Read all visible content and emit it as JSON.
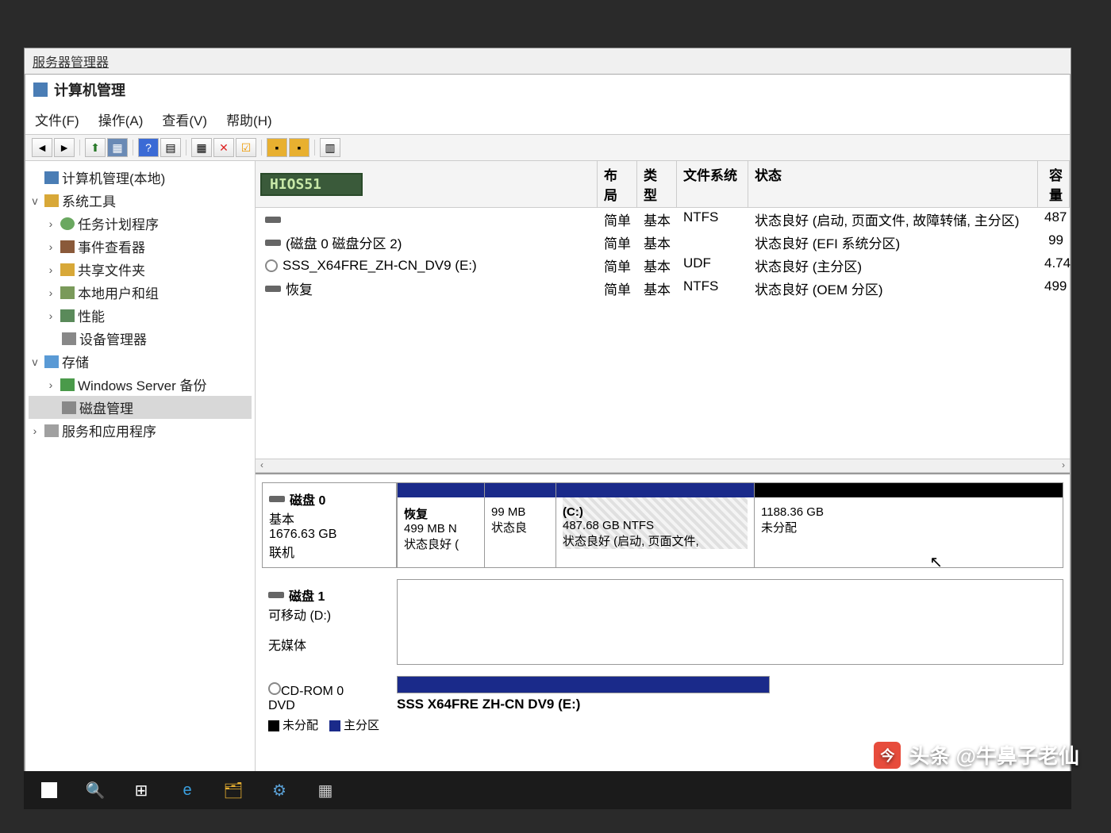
{
  "parentWindow": "服务器管理器",
  "window": {
    "title": "计算机管理",
    "menu": {
      "file": "文件(F)",
      "action": "操作(A)",
      "view": "查看(V)",
      "help": "帮助(H)"
    }
  },
  "tree": {
    "root": "计算机管理(本地)",
    "systemTools": "系统工具",
    "taskScheduler": "任务计划程序",
    "eventViewer": "事件查看器",
    "sharedFolders": "共享文件夹",
    "localUsers": "本地用户和组",
    "performance": "性能",
    "deviceManager": "设备管理器",
    "storage": "存储",
    "wsBackup": "Windows Server 备份",
    "diskMgmt": "磁盘管理",
    "services": "服务和应用程序"
  },
  "headerTag": "HIOS51",
  "columns": {
    "layout": "布局",
    "type": "类型",
    "fs": "文件系统",
    "status": "状态",
    "capacity": "容量"
  },
  "volumes": [
    {
      "name": "",
      "icon": "disk",
      "layout": "简单",
      "type": "基本",
      "fs": "NTFS",
      "status": "状态良好 (启动, 页面文件, 故障转储, 主分区)",
      "cap": "487"
    },
    {
      "name": "(磁盘 0 磁盘分区 2)",
      "icon": "disk",
      "layout": "简单",
      "type": "基本",
      "fs": "",
      "status": "状态良好 (EFI 系统分区)",
      "cap": "99"
    },
    {
      "name": "SSS_X64FRE_ZH-CN_DV9 (E:)",
      "icon": "cd",
      "layout": "简单",
      "type": "基本",
      "fs": "UDF",
      "status": "状态良好 (主分区)",
      "cap": "4.74"
    },
    {
      "name": "恢复",
      "icon": "disk",
      "layout": "简单",
      "type": "基本",
      "fs": "NTFS",
      "status": "状态良好 (OEM 分区)",
      "cap": "499"
    }
  ],
  "disk0": {
    "title": "磁盘 0",
    "type": "基本",
    "size": "1676.63 GB",
    "status": "联机",
    "parts": [
      {
        "name": "恢复",
        "info": "499 MB N",
        "status": "状态良好 ("
      },
      {
        "name": "",
        "info": "99 MB",
        "status": "状态良"
      },
      {
        "name": "(C:)",
        "info": "487.68 GB NTFS",
        "status": "状态良好 (启动, 页面文件,"
      },
      {
        "name": "",
        "info": "1188.36 GB",
        "status": "未分配"
      }
    ]
  },
  "disk1": {
    "title": "磁盘 1",
    "type": "可移动 (D:)",
    "status": "无媒体"
  },
  "cdrom": {
    "title": "CD-ROM 0",
    "type": "DVD",
    "volume": "SSS X64FRE ZH-CN DV9 (E:)"
  },
  "legend": {
    "unalloc": "未分配",
    "primary": "主分区"
  },
  "watermark": "头条 @牛鼻子老仙"
}
